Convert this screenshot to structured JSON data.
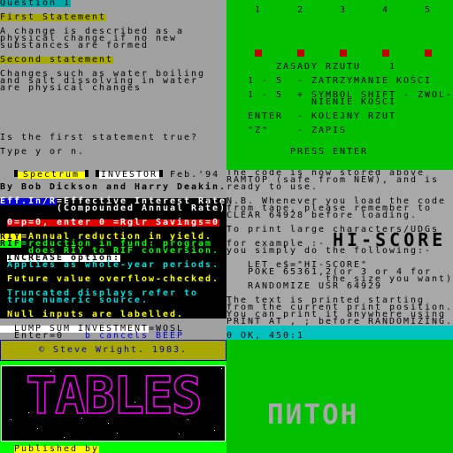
{
  "quiz": {
    "title": "Question 1",
    "first_label": "First Statement",
    "first_lines": [
      "A change is described as a",
      "physical change if no new",
      "substances are formed"
    ],
    "second_label": "Second statement",
    "second_lines": [
      "Changes such as water boiling",
      "and salt dissolving in water",
      "are physical changes"
    ],
    "prompt": "Is the first statement true?",
    "input_hint": "Type y or n."
  },
  "dice": {
    "numbers": [
      "1",
      "2",
      "3",
      "4",
      "5"
    ],
    "heading": "ZASADY RZUTU    1",
    "rules": [
      "1 - 5  - ZATRZYMANIE KOŚCI",
      "1 - 5  + SYMBOL SHIFT - ZWOL-",
      "         NIENIE KOŚCI",
      "ENTER  - KOLEJNY RZUT",
      "\"Z\"    - ZAPIS"
    ],
    "press": "PRESS ENTER",
    "colors": {
      "bg": "#00c000",
      "die": "#c00000"
    }
  },
  "investor": {
    "brand1": "Spectrum",
    "brand2": "INVESTOR",
    "date": "Feb.'94",
    "authors": "By Bob Dickson and Harry Deakin.",
    "eff_key": "Eff.In/R",
    "eff_text": "=Effective Interest Rate",
    "eff_text2": "        (Compounded Annual Rate)",
    "red_bar": "0=p=0, enter 0 =Rglr Savings=0",
    "riy_key": "RIY",
    "riy_text": "=Annual reduction in yield.",
    "rif_key": "RIF",
    "rif_text": "=reduction in fund: program",
    "rif_text2": "    does RIY to RIF conversion.",
    "increase": "INCREASE option:",
    "applies": "Applies as whole-year periods.",
    "future": "Future value overflow-checked.",
    "trunc1": "Truncated displays refer to",
    "trunc2": "true numeric source.",
    "null": "Null inputs are labelled.",
    "lump": "  LUMP SUM INVESTMENT",
    "lump_code": "=WOSL",
    "enter": "  Enter=0",
    "cancel": "b cancels BEEP"
  },
  "code": {
    "lines1": [
      "The code is now stored above",
      "RAMTOP (safe from NEW), and is",
      "ready to use."
    ],
    "lines2": [
      "N.B. Whenever you load the code",
      "from tape, please remember to",
      "CLEAR 64928 before loading."
    ],
    "large": "To print large characters/UDGs",
    "example": "for example :-",
    "big": "HI-SCORE",
    "follow": "you simply do the following:-",
    "prog": [
      "   LET e$=\"HI-SCORE\"",
      "   POKE 65361,2(or 3 or 4 for",
      "              the size you want)",
      "   RANDOMIZE USR 64929"
    ],
    "lines3": [
      "The text is printed starting",
      "from the current print position.",
      "You can print it anywhere using",
      "PRINT AT_,_; before RANDOMIZING."
    ],
    "status": "0 OK, 450:1"
  },
  "tables": {
    "copyright": "© Steve Wright. 1983.",
    "logo": "TABLES",
    "published": "Published by"
  },
  "piton": {
    "logo": "ПИТОН"
  }
}
